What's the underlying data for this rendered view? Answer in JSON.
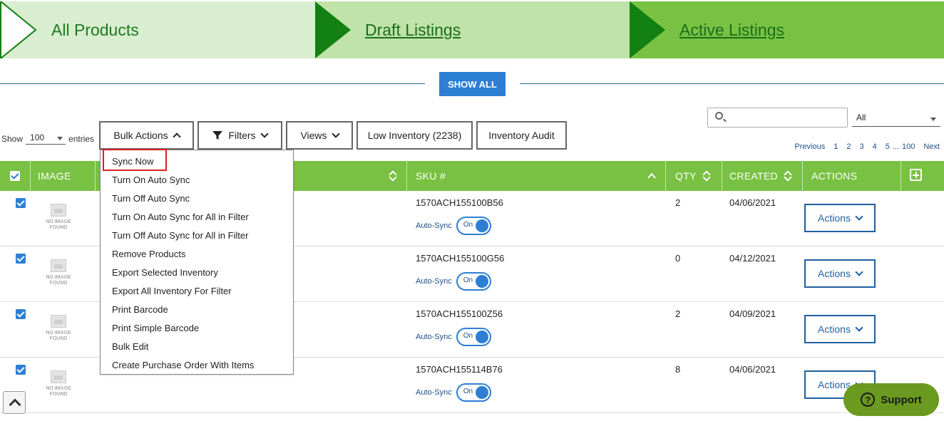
{
  "steps": [
    {
      "label": "All Products"
    },
    {
      "label": "Draft Listings"
    },
    {
      "label": "Active Listings"
    }
  ],
  "show_all": "SHOW ALL",
  "entries": {
    "prefix": "Show",
    "value": "100",
    "suffix": "entries"
  },
  "toolbar": {
    "bulk_actions": "Bulk Actions",
    "filters": "Filters",
    "views": "Views",
    "low_inventory": "Low Inventory (2238)",
    "inventory_audit": "Inventory Audit"
  },
  "search": {
    "placeholder": ""
  },
  "scope_select": "All",
  "pagination": {
    "previous": "Previous",
    "pages": [
      "1",
      "2",
      "3",
      "4",
      "5",
      "...",
      "100"
    ],
    "next": "Next"
  },
  "table": {
    "headers": {
      "image": "IMAGE",
      "sku": "SKU #",
      "qty": "QTY",
      "created": "CREATED",
      "actions": "ACTIONS"
    },
    "rows": [
      {
        "sku": "1570ACH155100B56",
        "qty": "2",
        "created": "04/06/2021"
      },
      {
        "sku": "1570ACH155100G56",
        "qty": "0",
        "created": "04/12/2021"
      },
      {
        "sku": "1570ACH155100Z56",
        "qty": "2",
        "created": "04/09/2021"
      },
      {
        "sku": "1570ACH155114B76",
        "qty": "8",
        "created": "04/06/2021"
      }
    ],
    "noimage_line1": "NO IMAGE",
    "noimage_line2": "FOUND",
    "autosync_label": "Auto-Sync",
    "toggle_label": "On",
    "actions_label": "Actions"
  },
  "bulk_menu": [
    "Sync Now",
    "Turn On Auto Sync",
    "Turn Off Auto Sync",
    "Turn On Auto Sync for All in Filter",
    "Turn Off Auto Sync for All in Filter",
    "Remove Products",
    "Export Selected Inventory",
    "Export All Inventory For Filter",
    "Print Barcode",
    "Print Simple Barcode",
    "Bulk Edit",
    "Create Purchase Order With Items"
  ],
  "support": "Support",
  "colors": {
    "banner_light": "#d9edd0",
    "banner_mid": "#bfe3a8",
    "banner_dark": "#78c142",
    "arrow": "#128012",
    "primary": "#2d7fd3",
    "highlight": "#e02020"
  }
}
